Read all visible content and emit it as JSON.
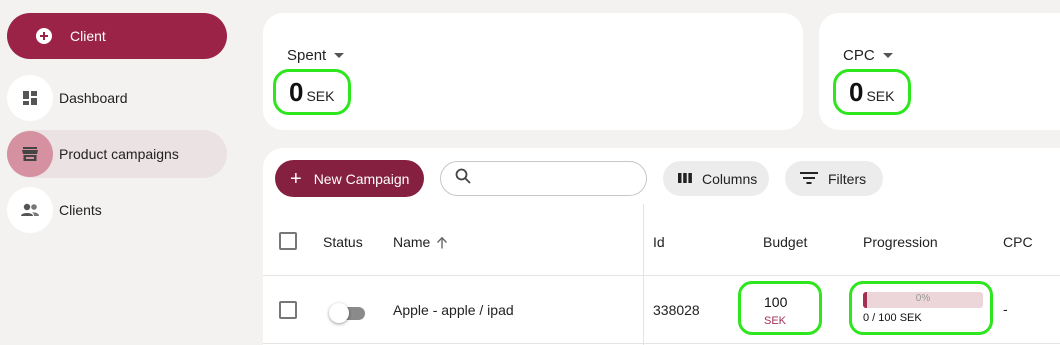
{
  "sidebar": {
    "client_button": "Client",
    "items": [
      {
        "label": "Dashboard",
        "icon": "dashboard-icon"
      },
      {
        "label": "Product campaigns",
        "icon": "store-icon",
        "active": true
      },
      {
        "label": "Clients",
        "icon": "people-icon"
      }
    ]
  },
  "stats": [
    {
      "title": "Spent",
      "value": "0",
      "unit": "SEK"
    },
    {
      "title": "CPC",
      "value": "0",
      "unit": "SEK"
    }
  ],
  "toolbar": {
    "new_campaign": "New Campaign",
    "search_value": "",
    "search_placeholder": "",
    "columns": "Columns",
    "filters": "Filters"
  },
  "table": {
    "headers": {
      "status": "Status",
      "name": "Name",
      "id": "Id",
      "budget": "Budget",
      "progression": "Progression",
      "cpc": "CPC"
    },
    "rows": [
      {
        "status_on": false,
        "name": "Apple - apple / ipad",
        "id": "338028",
        "budget_amount": "100",
        "budget_currency": "SEK",
        "progress_fraction": 0,
        "progress_pct": "0%",
        "progress_text": "0 / 100 SEK",
        "cpc": "-"
      }
    ]
  },
  "colors": {
    "primary": "#9b2348",
    "new_campaign": "#852040",
    "highlight": "#2ee61e",
    "active_nav": "#ebe2e3"
  }
}
